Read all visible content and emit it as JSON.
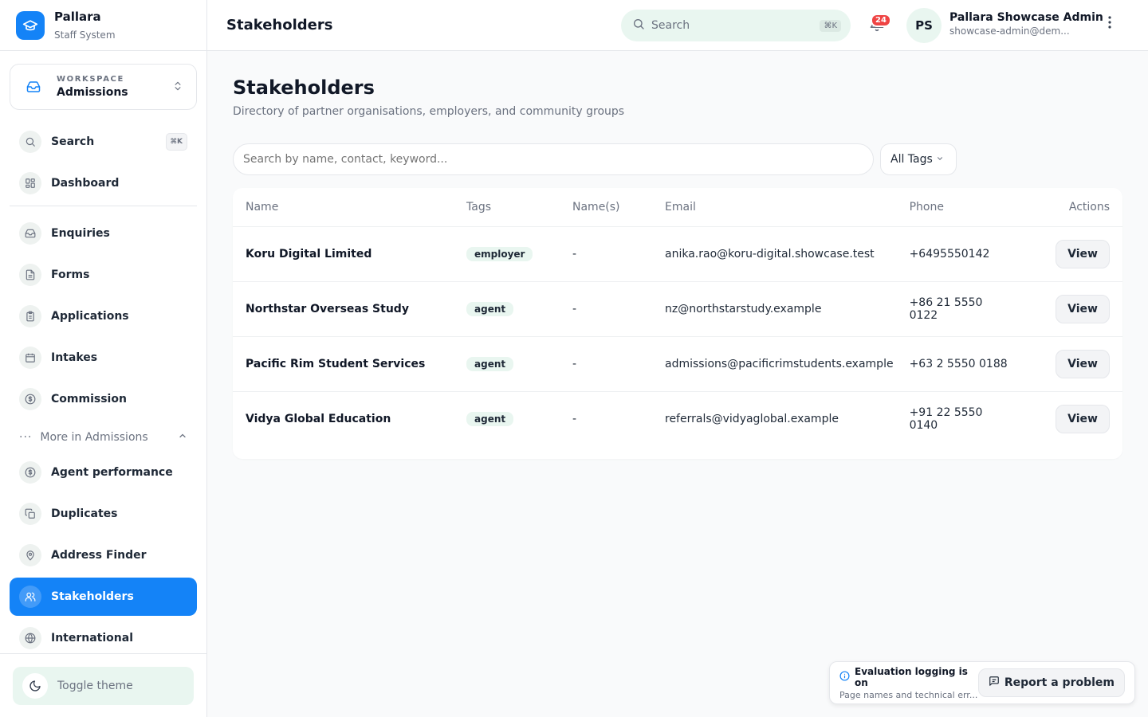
{
  "brand": {
    "name": "Pallara",
    "subtitle": "Staff System"
  },
  "workspace": {
    "label": "WORKSPACE",
    "value": "Admissions"
  },
  "sidebar": {
    "search": {
      "label": "Search",
      "shortcut": "⌘K"
    },
    "dashboard": "Dashboard",
    "items": [
      {
        "label": "Enquiries",
        "icon": "inbox-icon"
      },
      {
        "label": "Forms",
        "icon": "document-icon"
      },
      {
        "label": "Applications",
        "icon": "clipboard-icon"
      },
      {
        "label": "Intakes",
        "icon": "calendar-icon"
      },
      {
        "label": "Commission",
        "icon": "dollar-icon"
      }
    ],
    "more_label": "More in Admissions",
    "more_items": [
      {
        "label": "Agent performance",
        "icon": "dollar-icon"
      },
      {
        "label": "Duplicates",
        "icon": "copy-icon"
      },
      {
        "label": "Address Finder",
        "icon": "map-pin-icon"
      },
      {
        "label": "Stakeholders",
        "icon": "users-icon",
        "active": true
      },
      {
        "label": "International",
        "icon": "globe-icon"
      }
    ],
    "toggle_theme": "Toggle theme"
  },
  "header": {
    "title": "Stakeholders",
    "search_placeholder": "Search",
    "search_shortcut": "⌘K",
    "notification_count": "24",
    "user_initials": "PS",
    "user_name": "Pallara Showcase Admin",
    "user_email": "showcase-admin@dem..."
  },
  "main": {
    "title": "Stakeholders",
    "subtitle": "Directory of partner organisations, employers, and community groups",
    "filter_placeholder": "Search by name, contact, keyword...",
    "tag_filter": "All Tags",
    "columns": {
      "name": "Name",
      "tags": "Tags",
      "names": "Name(s)",
      "email": "Email",
      "phone": "Phone",
      "actions": "Actions"
    },
    "rows": [
      {
        "name": "Koru Digital Limited",
        "tag": "employer",
        "names": "-",
        "email": "anika.rao@koru-digital.showcase.test",
        "phone": "+6495550142",
        "action": "View"
      },
      {
        "name": "Northstar Overseas Study",
        "tag": "agent",
        "names": "-",
        "email": "nz@northstarstudy.example",
        "phone": "+86 21 5550 0122",
        "action": "View"
      },
      {
        "name": "Pacific Rim Student Services",
        "tag": "agent",
        "names": "-",
        "email": "admissions@pacificrimstudents.example",
        "phone": "+63 2 5550 0188",
        "action": "View"
      },
      {
        "name": "Vidya Global Education",
        "tag": "agent",
        "names": "-",
        "email": "referrals@vidyaglobal.example",
        "phone": "+91 22 5550 0140",
        "action": "View"
      }
    ]
  },
  "eval": {
    "title": "Evaluation logging is on",
    "subtitle": "Page names and technical err...",
    "report_label": "Report a problem"
  },
  "colors": {
    "accent": "#1483f7",
    "mint": "#e9f6f0",
    "badge": "#ef4444"
  }
}
